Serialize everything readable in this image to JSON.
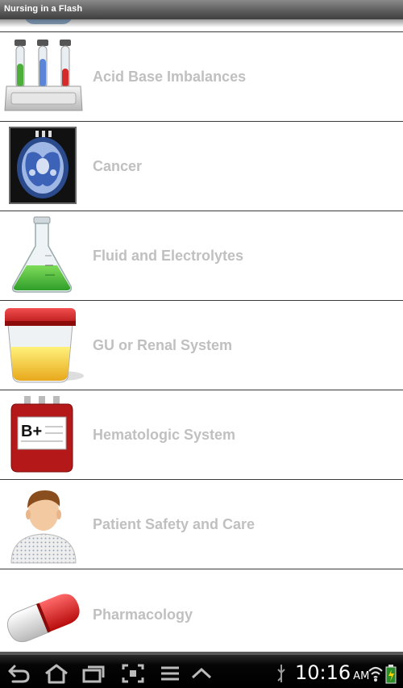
{
  "app": {
    "title": "Nursing in a Flash"
  },
  "categories": [
    {
      "label": "Acid Base Imbalances",
      "icon": "test-tubes-icon"
    },
    {
      "label": "Cancer",
      "icon": "brain-scan-icon"
    },
    {
      "label": "Fluid and Electrolytes",
      "icon": "flask-icon"
    },
    {
      "label": "GU or Renal System",
      "icon": "specimen-cup-icon"
    },
    {
      "label": "Hematologic System",
      "icon": "blood-bag-icon",
      "badge": "B+"
    },
    {
      "label": "Patient Safety and Care",
      "icon": "patient-icon"
    },
    {
      "label": "Pharmacology",
      "icon": "capsule-icon"
    }
  ],
  "status_bar": {
    "time": "10:16",
    "ampm": "AM"
  },
  "colors": {
    "label": "#c0c0c0",
    "titlebar": "#5e5e5e",
    "divider": "#3a3a3a"
  }
}
